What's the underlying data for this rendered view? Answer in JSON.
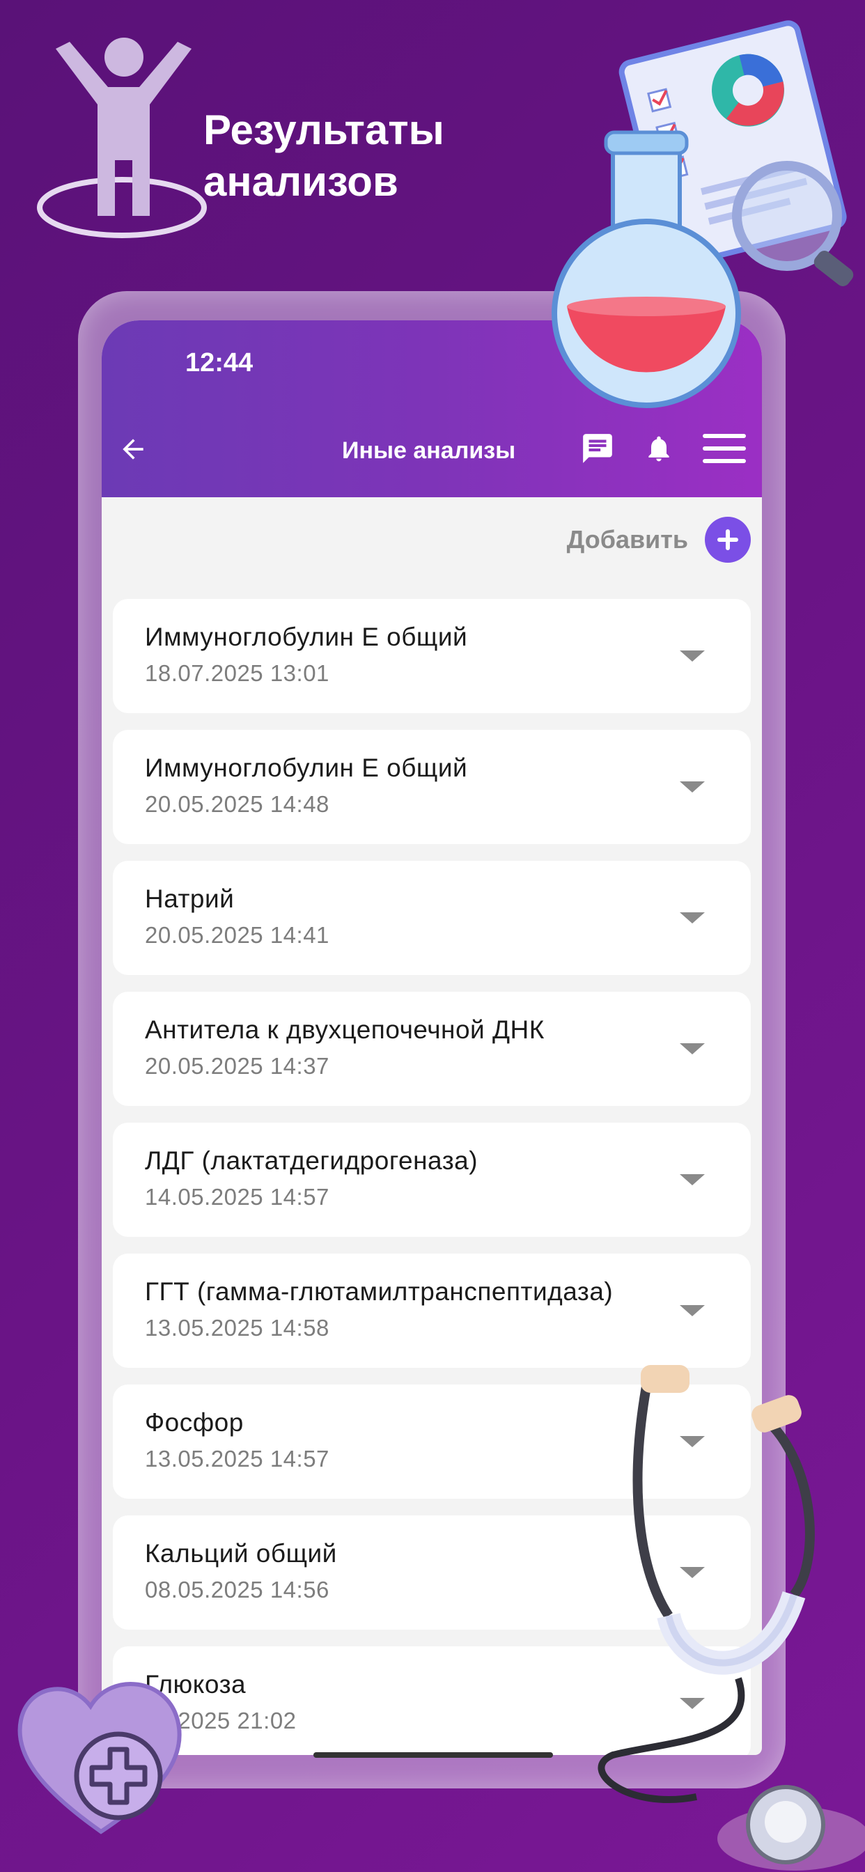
{
  "promo": {
    "title_line1": "Результаты",
    "title_line2": "анализов"
  },
  "status_bar": {
    "time": "12:44"
  },
  "appbar": {
    "title": "Иные анализы",
    "icons": [
      "back-arrow-icon",
      "chat-icon",
      "bell-icon",
      "hamburger-menu-icon"
    ]
  },
  "add_button": {
    "label": "Добавить"
  },
  "tests": [
    {
      "title": "Иммуноглобулин Е общий",
      "date": "18.07.2025 13:01"
    },
    {
      "title": "Иммуноглобулин Е общий",
      "date": "20.05.2025 14:48"
    },
    {
      "title": "Натрий",
      "date": "20.05.2025 14:41"
    },
    {
      "title": "Антитела к двухцепочечной ДНК",
      "date": "20.05.2025 14:37"
    },
    {
      "title": "ЛДГ (лактатдегидрогеназа)",
      "date": "14.05.2025 14:57"
    },
    {
      "title": "ГГТ (гамма-глютамилтранспептидаза)",
      "date": "13.05.2025 14:58"
    },
    {
      "title": "Фосфор",
      "date": "13.05.2025 14:57"
    },
    {
      "title": "Кальций общий",
      "date": "08.05.2025 14:56"
    },
    {
      "title": "Глюкоза",
      "date": "04.2025 21:02"
    }
  ],
  "colors": {
    "background": "#6a1486",
    "appbar_start": "#6c3ab5",
    "appbar_end": "#9b2fc4",
    "accent": "#7b4fe6"
  }
}
